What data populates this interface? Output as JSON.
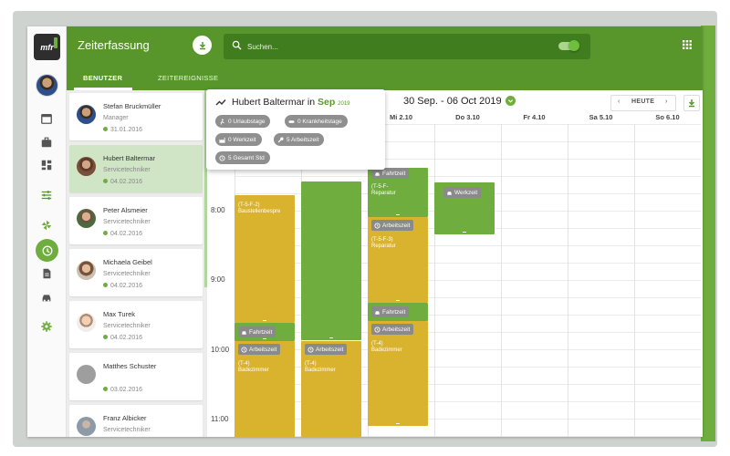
{
  "app": {
    "logo_text": "mfr",
    "title": "Zeiterfassung",
    "search_placeholder": "Suchen..."
  },
  "tabs": [
    {
      "label": "BENUTZER",
      "active": true
    },
    {
      "label": "ZEITEREIGNISSE",
      "active": false
    }
  ],
  "employees": [
    {
      "name": "Stefan Bruckmüller",
      "role": "Manager",
      "date": "31.01.2016"
    },
    {
      "name": "Hubert Baltermar",
      "role": "Servicetechniker",
      "date": "04.02.2016",
      "active": true
    },
    {
      "name": "Peter Alsmeier",
      "role": "Servicetechniker",
      "date": "04.02.2016"
    },
    {
      "name": "Michaela Geibel",
      "role": "Servicetechniker",
      "date": "04.02.2016"
    },
    {
      "name": "Max Turek",
      "role": "Servicetechniker",
      "date": "04.02.2016"
    },
    {
      "name": "Matthes Schuster",
      "role": "",
      "date": "03.02.2016"
    },
    {
      "name": "Franz Albicker",
      "role": "Servicetechniker",
      "date": ""
    }
  ],
  "summary": {
    "name": "Hubert Baltermar",
    "in_word": "in",
    "month": "Sep",
    "year": "2019",
    "pills": [
      {
        "icon": "walk-icon",
        "text": "0 Urlaubstage"
      },
      {
        "icon": "bandage-icon",
        "text": "0 Krankheitstage"
      },
      {
        "icon": "factory-icon",
        "text": "0 Werkzeit"
      },
      {
        "icon": "wrench-icon",
        "text": "5 Arbeitszeit"
      },
      {
        "icon": "clock-icon",
        "text": "5 Gesamt Std"
      }
    ]
  },
  "calendar": {
    "range": "30 Sep. - 06 Oct 2019",
    "today_label": "HEUTE",
    "prev": "‹",
    "next": "›",
    "visible_days": [
      "Mi 2.10",
      "Do 3.10",
      "Fr 4.10",
      "Sa 5.10",
      "So 6.10"
    ],
    "times": [
      "8:00",
      "9:00",
      "10:00",
      "11:00"
    ]
  },
  "events": {
    "mon_block_label": "(T-5-F-2)",
    "mon_block_sub": "Baustellenbespre",
    "fahrtzeit": "Fahrtzeit",
    "arbeitszeit": "Arbeitszeit",
    "werkzeit": "Werkzeit",
    "t4": "(T-4)",
    "badezimmer": "Badezimmer",
    "wed_top_label": "(T-5-F-",
    "reparatur": "Reparatur",
    "wed_mid_label": "(T-5-F-3)"
  },
  "colors": {
    "brand_green": "#58962c",
    "event_green": "#6fad3e",
    "event_yellow": "#d9b22e"
  }
}
